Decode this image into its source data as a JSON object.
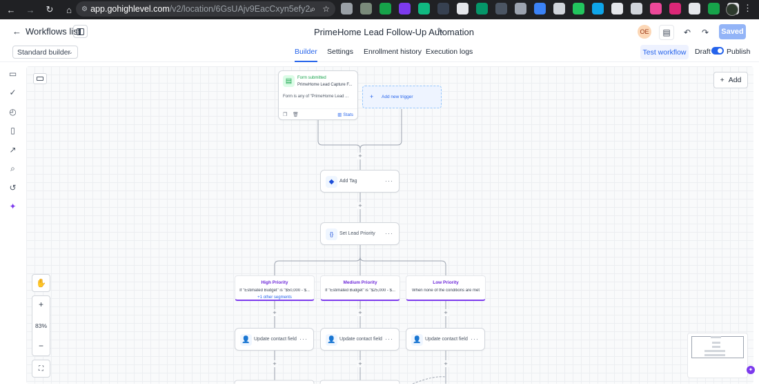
{
  "browser": {
    "url_domain": "app.gohighlevel.com",
    "url_path": "/v2/location/6GsUAjv9EacCxyn5efy2/auto..."
  },
  "header": {
    "back_label": "Workflows list",
    "workflow_title": "PrimeHome Lead Follow-Up Automation",
    "avatar_initials": "OE",
    "saved_label": "Saved"
  },
  "tabrow": {
    "builder_select": "Standard builder",
    "tabs": [
      {
        "label": "Builder",
        "active": true
      },
      {
        "label": "Settings",
        "active": false
      },
      {
        "label": "Enrollment history",
        "active": false
      },
      {
        "label": "Execution logs",
        "active": false
      }
    ],
    "test_workflow": "Test workflow",
    "draft": "Draft",
    "publish": "Publish"
  },
  "canvas": {
    "add_label": "Add",
    "trigger": {
      "type": "Form submitted",
      "name": "PrimeHome Lead Capture F...",
      "condition": "Form is any of \"PrimeHome Lead ...",
      "stats": "Stats"
    },
    "add_trigger": "Add new trigger",
    "actions": {
      "add_tag": "Add Tag",
      "set_priority": "Set Lead Priority"
    },
    "branches": [
      {
        "title": "High Priority",
        "condition": "If \"Estimated Budget\" is \"$50,000 - $...",
        "extra": "+1 other segments"
      },
      {
        "title": "Medium Priority",
        "condition": "If \"Estimated Budget\" is \"$25,000 - $...",
        "extra": ""
      },
      {
        "title": "Low Priority",
        "condition": "When none of the conditions are met",
        "extra": ""
      }
    ],
    "update_label": "Update contact field",
    "zoom": "83%"
  },
  "colors": {
    "accent": "#2563eb",
    "branch": "#7c3aed",
    "saved_bg": "#93b4f7"
  }
}
